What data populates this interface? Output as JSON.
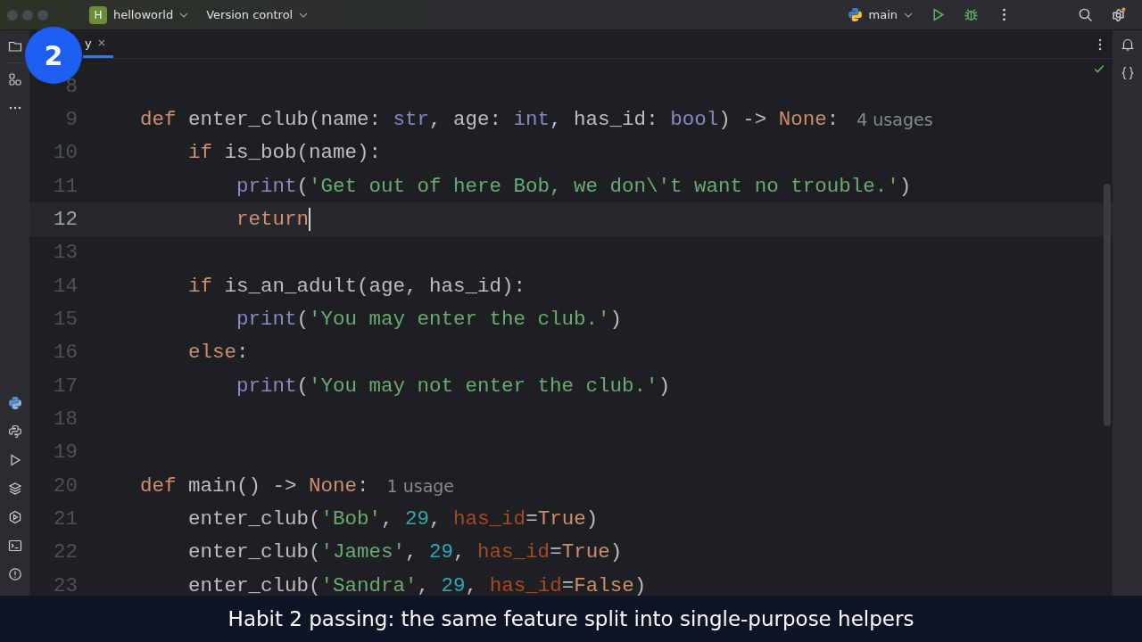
{
  "title_bar": {
    "project_badge": "H",
    "project": "helloworld",
    "vcs": "Version control",
    "run_config": "main"
  },
  "tab": {
    "label": "y",
    "selected": true
  },
  "step_badge": "2",
  "code_lines": [
    {
      "number": "8",
      "current": false
    },
    {
      "number": "9",
      "current": false,
      "tokens": [
        {
          "kind": "kw",
          "text": "def "
        },
        {
          "kind": "plain",
          "text": "enter_club(name: "
        },
        {
          "kind": "builtin",
          "text": "str"
        },
        {
          "kind": "plain",
          "text": ", age: "
        },
        {
          "kind": "builtin",
          "text": "int"
        },
        {
          "kind": "plain",
          "text": ", has_id: "
        },
        {
          "kind": "builtin",
          "text": "bool"
        },
        {
          "kind": "plain",
          "text": ") -> "
        },
        {
          "kind": "kw",
          "text": "None"
        },
        {
          "kind": "plain",
          "text": ":"
        },
        {
          "kind": "hint",
          "text": "4 usages"
        }
      ]
    },
    {
      "number": "10",
      "current": false,
      "tokens": [
        {
          "kind": "kw",
          "text": "    if "
        },
        {
          "kind": "plain",
          "text": "is_bob(name):"
        }
      ]
    },
    {
      "number": "11",
      "current": false,
      "tokens": [
        {
          "kind": "builtin",
          "text": "        print"
        },
        {
          "kind": "plain",
          "text": "("
        },
        {
          "kind": "str",
          "text": "'Get out of here Bob, we don\\'t want no trouble.'"
        },
        {
          "kind": "plain",
          "text": ")"
        }
      ]
    },
    {
      "number": "12",
      "current": true,
      "tokens": [
        {
          "kind": "kw",
          "text": "        return"
        }
      ]
    },
    {
      "number": "13",
      "current": false
    },
    {
      "number": "14",
      "current": false,
      "tokens": [
        {
          "kind": "kw",
          "text": "    if "
        },
        {
          "kind": "plain",
          "text": "is_an_adult(age, has_id):"
        }
      ]
    },
    {
      "number": "15",
      "current": false,
      "tokens": [
        {
          "kind": "builtin",
          "text": "        print"
        },
        {
          "kind": "plain",
          "text": "("
        },
        {
          "kind": "str",
          "text": "'You may enter the club.'"
        },
        {
          "kind": "plain",
          "text": ")"
        }
      ]
    },
    {
      "number": "16",
      "current": false,
      "tokens": [
        {
          "kind": "kw",
          "text": "    else"
        },
        {
          "kind": "plain",
          "text": ":"
        }
      ]
    },
    {
      "number": "17",
      "current": false,
      "tokens": [
        {
          "kind": "builtin",
          "text": "        print"
        },
        {
          "kind": "plain",
          "text": "("
        },
        {
          "kind": "str",
          "text": "'You may not enter the club.'"
        },
        {
          "kind": "plain",
          "text": ")"
        }
      ]
    },
    {
      "number": "18",
      "current": false
    },
    {
      "number": "19",
      "current": false
    },
    {
      "number": "20",
      "current": false,
      "tokens": [
        {
          "kind": "kw",
          "text": "def "
        },
        {
          "kind": "plain",
          "text": "main() -> "
        },
        {
          "kind": "kw",
          "text": "None"
        },
        {
          "kind": "plain",
          "text": ":"
        },
        {
          "kind": "hint",
          "text": "1 usage"
        }
      ]
    },
    {
      "number": "21",
      "current": false,
      "tokens": [
        {
          "kind": "plain",
          "text": "    enter_club("
        },
        {
          "kind": "str",
          "text": "'Bob'"
        },
        {
          "kind": "plain",
          "text": ", "
        },
        {
          "kind": "num",
          "text": "29"
        },
        {
          "kind": "plain",
          "text": ", "
        },
        {
          "kind": "kwarg",
          "text": "has_id"
        },
        {
          "kind": "plain",
          "text": "="
        },
        {
          "kind": "kw",
          "text": "True"
        },
        {
          "kind": "plain",
          "text": ")"
        }
      ]
    },
    {
      "number": "22",
      "current": false,
      "tokens": [
        {
          "kind": "plain",
          "text": "    enter_club("
        },
        {
          "kind": "str",
          "text": "'James'"
        },
        {
          "kind": "plain",
          "text": ", "
        },
        {
          "kind": "num",
          "text": "29"
        },
        {
          "kind": "plain",
          "text": ", "
        },
        {
          "kind": "kwarg",
          "text": "has_id"
        },
        {
          "kind": "plain",
          "text": "="
        },
        {
          "kind": "kw",
          "text": "True"
        },
        {
          "kind": "plain",
          "text": ")"
        }
      ]
    },
    {
      "number": "23",
      "current": false,
      "tokens": [
        {
          "kind": "plain",
          "text": "    enter_club("
        },
        {
          "kind": "str",
          "text": "'Sandra'"
        },
        {
          "kind": "plain",
          "text": ", "
        },
        {
          "kind": "num",
          "text": "29"
        },
        {
          "kind": "plain",
          "text": ", "
        },
        {
          "kind": "kwarg",
          "text": "has_id"
        },
        {
          "kind": "plain",
          "text": "="
        },
        {
          "kind": "kw",
          "text": "False"
        },
        {
          "kind": "plain",
          "text": ")"
        }
      ]
    }
  ],
  "caption": "Habit 2 passing: the same feature split into single-purpose helpers"
}
